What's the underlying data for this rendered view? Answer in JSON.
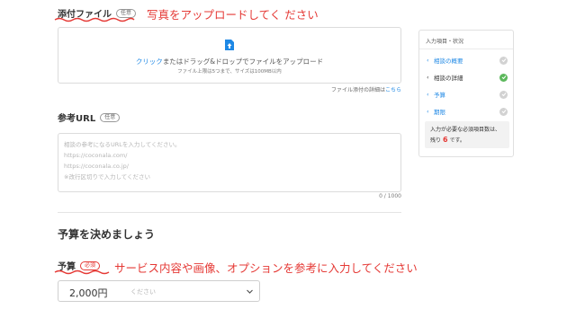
{
  "attachment": {
    "title": "添付ファイル",
    "badge": "任意",
    "annotation": "写真をアップロードしてく ださい",
    "upload_link": "クリック",
    "upload_text": "またはドラッグ&ドロップでファイルをアップロード",
    "upload_limits": "ファイル上限は5つまで、サイズは100MB以内",
    "detail_prefix": "ファイル添付の詳細は",
    "detail_link": "こちら"
  },
  "reference_url": {
    "title": "参考URL",
    "badge": "任意",
    "placeholder_lines": [
      "相談の参考になるURLを入力してください。",
      "https://coconala.com/",
      "https://coconala.co.jp/",
      "※改行区切りで入力してください"
    ],
    "counter": "0 / 1000"
  },
  "budget_section": {
    "heading": "予算を決めましょう",
    "title": "予算",
    "badge": "必須",
    "annotation": "サービス内容や画像、オプションを参考に入力してください",
    "placeholder": "ください",
    "value": "2,000円"
  },
  "sidebar": {
    "title": "入力項目・状況",
    "items": [
      {
        "label": "相談の概要",
        "state": "link",
        "status": "pending"
      },
      {
        "label": "相談の詳細",
        "state": "active",
        "status": "done"
      },
      {
        "label": "予算",
        "state": "link",
        "status": "pending"
      },
      {
        "label": "期限",
        "state": "link",
        "status": "pending"
      }
    ],
    "info_line1": "入力が必要な必須項目数は、",
    "info_prefix": "残り",
    "info_count": "6",
    "info_suffix": "です。"
  },
  "colors": {
    "accent_red": "#e53935",
    "link_blue": "#1e88e5",
    "done_green": "#5cb85c"
  }
}
